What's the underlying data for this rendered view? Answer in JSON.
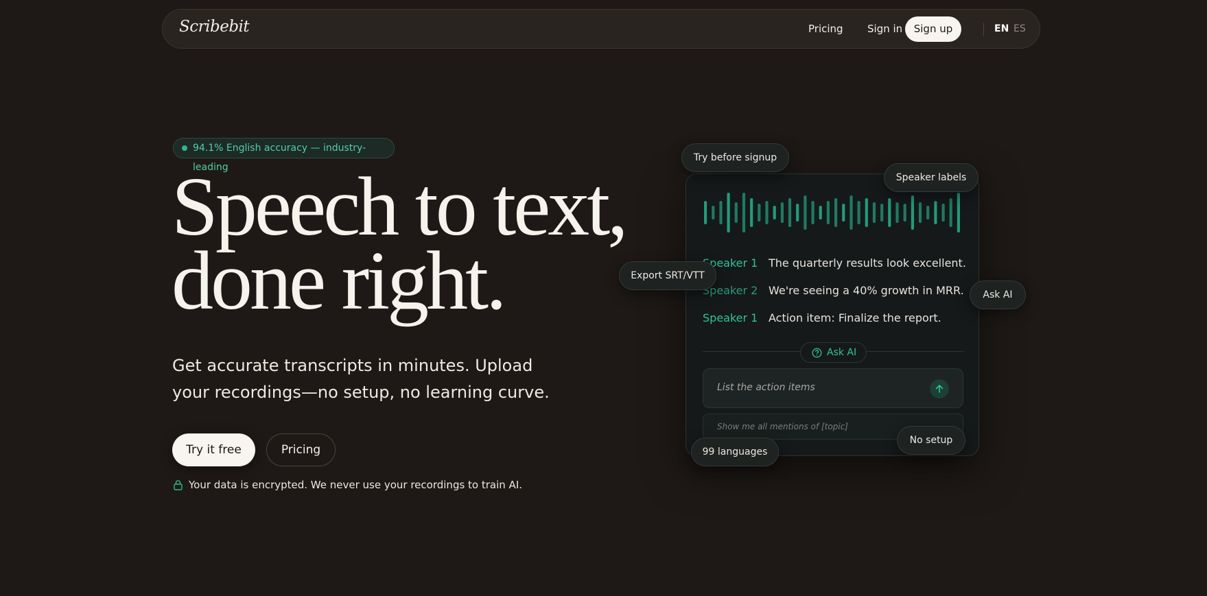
{
  "nav": {
    "logo": "Scribebit",
    "pricing": "Pricing",
    "sign_in": "Sign in",
    "sign_up": "Sign up",
    "lang_en": "EN",
    "lang_es": "ES"
  },
  "hero": {
    "badge": "94.1% English accuracy — industry-leading",
    "headline_line1": "Speech to text,",
    "headline_line2": "done right.",
    "subtitle": "Get accurate transcripts in minutes. Upload your recordings—no setup, no learning curve.",
    "cta_primary": "Try it free",
    "cta_secondary": "Pricing",
    "privacy_note": "Your data is encrypted. We never use your recordings to train AI."
  },
  "demo": {
    "transcript": [
      {
        "speaker": "Speaker 1",
        "text": "The quarterly results look excellent."
      },
      {
        "speaker": "Speaker 2",
        "text": "We're seeing a 40% growth in MRR."
      },
      {
        "speaker": "Speaker 1",
        "text": "Action item: Finalize the report."
      }
    ],
    "ask_ai_label": "Ask AI",
    "query_placeholder": "List the action items",
    "suggestion": "Show me all mentions of [topic]"
  },
  "chips": {
    "try_before": "Try before signup",
    "speaker_labels": "Speaker labels",
    "export": "Export SRT/VTT",
    "ask_ai": "Ask AI",
    "languages": "99 languages",
    "no_setup": "No setup"
  },
  "colors": {
    "background": "#1e1916",
    "accent": "#2fc49a",
    "card": "#151919"
  },
  "icons": {
    "ask": "help-circle-icon",
    "send": "arrow-up-icon",
    "lock": "lock-icon"
  }
}
